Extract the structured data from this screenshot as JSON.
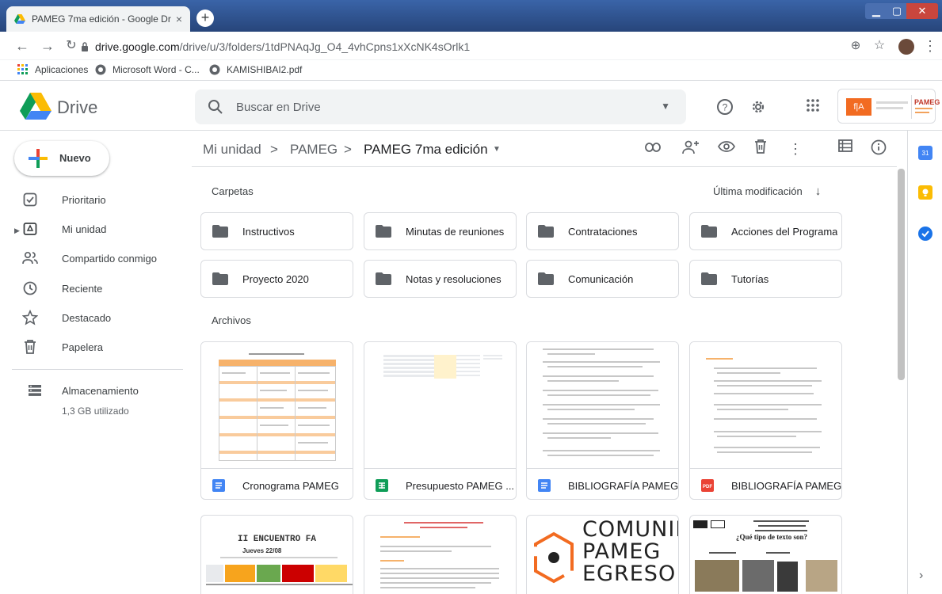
{
  "browser": {
    "tab_title": "PAMEG 7ma edición - Google Dr",
    "tab_close": "×",
    "new_tab": "+",
    "url_host": "drive.google.com",
    "url_path": "/drive/u/3/folders/1tdPNAqJg_O4_4vhCpns1xXcNK4sOrlk1",
    "bookmarks": [
      "Aplicaciones",
      "Microsoft Word - C...",
      "KAMISHIBAI2.pdf"
    ]
  },
  "header": {
    "brand": "Drive",
    "search_placeholder": "Buscar en Drive",
    "org_badge_text": "PAMEG"
  },
  "sidebar": {
    "new_label": "Nuevo",
    "items": [
      {
        "label": "Prioritario",
        "icon": "check-square-icon"
      },
      {
        "label": "Mi unidad",
        "icon": "drive-icon"
      },
      {
        "label": "Compartido conmigo",
        "icon": "people-icon"
      },
      {
        "label": "Reciente",
        "icon": "clock-icon"
      },
      {
        "label": "Destacado",
        "icon": "star-icon"
      },
      {
        "label": "Papelera",
        "icon": "trash-icon"
      }
    ],
    "storage_label": "Almacenamiento",
    "storage_used": "1,3 GB utilizado"
  },
  "breadcrumb": {
    "root": "Mi unidad",
    "sep": ">",
    "parent": "PAMEG",
    "current": "PAMEG 7ma edición"
  },
  "main": {
    "folders_heading": "Carpetas",
    "sort_label": "Última modificación",
    "files_heading": "Archivos",
    "folders": [
      "Instructivos",
      "Minutas de reuniones",
      "Contrataciones",
      "Acciones del Programa",
      "Proyecto 2020",
      "Notas y resoluciones",
      "Comunicación",
      "Tutorías"
    ],
    "files": [
      {
        "name": "Cronograma PAMEG",
        "type": "doc"
      },
      {
        "name": "Presupuesto PAMEG ...",
        "type": "sheet"
      },
      {
        "name": "BIBLIOGRAFÍA PAMEG",
        "type": "doc"
      },
      {
        "name": "BIBLIOGRAFÍA PAMEG",
        "type": "pdf"
      }
    ],
    "row2_previews": {
      "encuentro_title": "II ENCUENTRO FA",
      "encuentro_date": "Jueves 22/08",
      "comunidad_lines": [
        "COMUNIDA",
        "PAMEG",
        "EGRESO"
      ],
      "tipo_texto": "¿Qué tipo de texto son?"
    }
  },
  "colors": {
    "doc_blue": "#4285f4",
    "sheet_green": "#0f9d58",
    "pdf_red": "#ea4335",
    "folder_gray": "#5f6368"
  }
}
